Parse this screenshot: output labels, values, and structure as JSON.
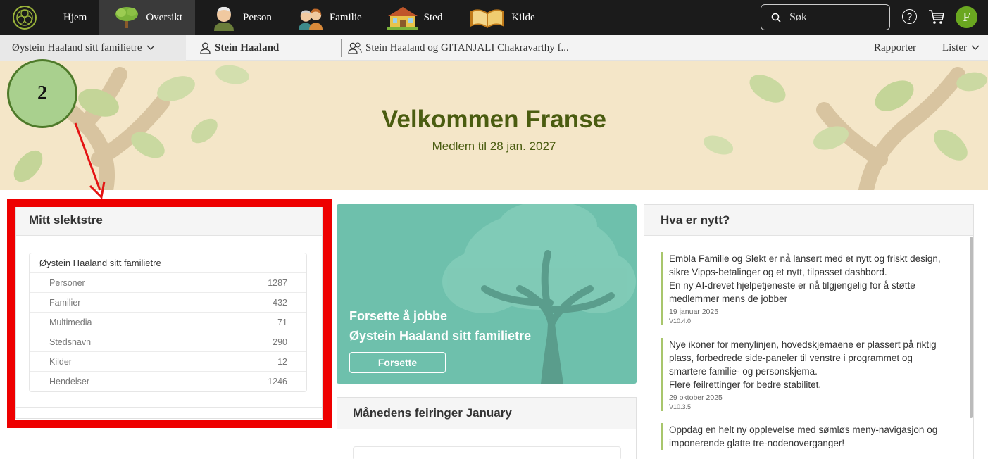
{
  "nav": {
    "items": [
      {
        "label": "Hjem",
        "icon": "home-icon",
        "active": false
      },
      {
        "label": "Oversikt",
        "icon": "tree-icon",
        "active": true
      },
      {
        "label": "Person",
        "icon": "person-portrait-icon",
        "active": false
      },
      {
        "label": "Familie",
        "icon": "family-portrait-icon",
        "active": false
      },
      {
        "label": "Sted",
        "icon": "house-icon",
        "active": false
      },
      {
        "label": "Kilde",
        "icon": "book-icon",
        "active": false
      }
    ],
    "search_placeholder": "Søk",
    "help_glyph": "?",
    "avatar_initial": "F"
  },
  "subnav": {
    "tree_name": "Øystein Haaland sitt familietre",
    "person": "Stein Haaland",
    "family": "Stein Haaland og GITANJALI Chakravarthy f...",
    "reports": "Rapporter",
    "lists": "Lister"
  },
  "banner": {
    "title": "Velkommen Franse",
    "subtitle": "Medlem til 28 jan. 2027"
  },
  "annotation": {
    "number": "2",
    "badge_color": "#a9d08e",
    "highlight_color": "#ee0000"
  },
  "my_tree": {
    "title": "Mitt slektstre",
    "tree_name": "Øystein Haaland sitt familietre",
    "rows": [
      {
        "label": "Personer",
        "value": "1287"
      },
      {
        "label": "Familier",
        "value": "432"
      },
      {
        "label": "Multimedia",
        "value": "71"
      },
      {
        "label": "Stedsnavn",
        "value": "290"
      },
      {
        "label": "Kilder",
        "value": "12"
      },
      {
        "label": "Hendelser",
        "value": "1246"
      }
    ]
  },
  "promo": {
    "line1": "Forsette å jobbe",
    "line2": "Øystein Haaland sitt familietre",
    "button": "Forsette",
    "color": "#6ec0ac"
  },
  "celebrations": {
    "title": "Månedens feiringer January"
  },
  "news": {
    "title": "Hva er nytt?",
    "items": [
      {
        "text1": "Embla Familie og Slekt er nå lansert med et nytt og friskt design, sikre Vipps-betalinger og et nytt, tilpasset dashbord.",
        "text2": "En ny AI-drevet hjelpetjeneste er nå tilgjengelig for å støtte medlemmer mens de jobber",
        "date": "19 januar 2025",
        "version": "V10.4.0"
      },
      {
        "text1": "Nye ikoner for menylinjen, hovedskjemaene er plassert på riktig plass, forbedrede side-paneler til venstre i programmet og smartere familie- og personskjema.",
        "text2": "Flere feilrettinger for bedre stabilitet.",
        "date": "29 oktober 2025",
        "version": "V10.3.5"
      },
      {
        "text1": "Oppdag en helt ny opplevelse med sømløs meny-navigasjon og imponerende glatte tre-nodenoverganger!",
        "text2": "",
        "date": "",
        "version": ""
      }
    ]
  }
}
